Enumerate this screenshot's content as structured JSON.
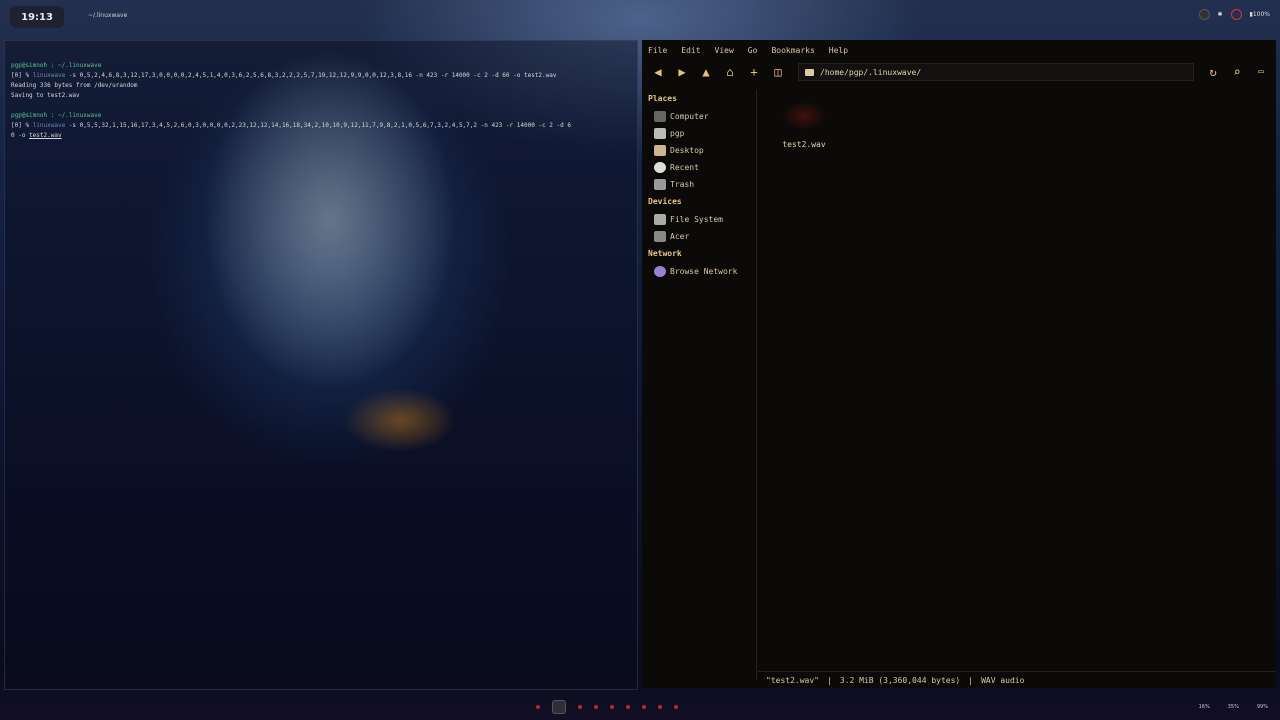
{
  "topbar": {
    "clock": "19:13",
    "window_title": "~/.linuxwave",
    "battery": "100%"
  },
  "terminal": {
    "lines": [
      {
        "kind": "prompt",
        "text": "pgp@simnoh : ~/.linuxwave"
      },
      {
        "kind": "cmd",
        "prefix": "[0] % ",
        "bin": "linuxwave",
        "args": " -s 0,5,2,4,6,8,3,12,17,3,0,0,0,0,2,4,5,1,4,0,3,6,2,5,6,8,3,2,2,2,5,7,19,12,12,9,9,0,0,12,3,8,16 -n 423 -r 14000 -c 2 -d 60 -o test2.wav"
      },
      {
        "kind": "out",
        "text": "Reading 336 bytes from /dev/urandom"
      },
      {
        "kind": "out",
        "text": "Saving to test2.wav"
      },
      {
        "kind": "blank",
        "text": ""
      },
      {
        "kind": "prompt",
        "text": "pgp@simnoh : ~/.linuxwave"
      },
      {
        "kind": "cmd",
        "prefix": "[0] % ",
        "bin": "linuxwave",
        "args": " -s 0,5,5,32,1,15,16,17,3,4,5,2,6,0,3,0,0,0,0,2,23,12,12,14,16,18,34,2,10,10,9,12,11,7,9,8,2,1,0,5,6,7,3,2,4,5,7,2 -n 423 -r 14000 -c 2 -d 6"
      },
      {
        "kind": "tail",
        "text": "0 -o ",
        "file": "test2.wav"
      }
    ]
  },
  "filemanager": {
    "menu": [
      "File",
      "Edit",
      "View",
      "Go",
      "Bookmarks",
      "Help"
    ],
    "path": "/home/pgp/.linuxwave/",
    "places_label": "Places",
    "places": [
      "Computer",
      "pgp",
      "Desktop",
      "Recent",
      "Trash"
    ],
    "devices_label": "Devices",
    "devices": [
      "File System",
      "Acer"
    ],
    "network_label": "Network",
    "network": [
      "Browse Network"
    ],
    "file_name": "test2.wav",
    "status": {
      "name": "\"test2.wav\"",
      "sep": "|",
      "size": "3.2 MiB (3,360,044 bytes)",
      "type": "WAV audio"
    }
  },
  "sysinfo": [
    "16%",
    "35%",
    "99%"
  ],
  "colors": {
    "accent": "#e8c27a",
    "prompt": "#58c48a",
    "dock_dot": "#c0262b"
  }
}
